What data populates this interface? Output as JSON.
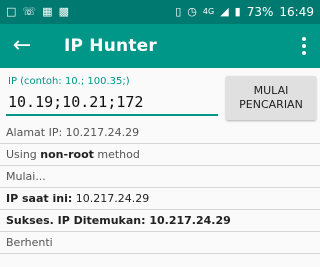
{
  "status_bar": {
    "battery": "73%",
    "time": "16:49",
    "icons": [
      "chat-bubble-icon",
      "whatsapp-icon",
      "image-icon",
      "bbm-icon",
      "sim-icon",
      "alarm-icon",
      "data-4g-icon",
      "signal-icon",
      "battery-icon"
    ]
  },
  "app_bar": {
    "title": "IP Hunter"
  },
  "form": {
    "ip_label": "IP (contoh: 10.; 100.35;)",
    "ip_value": "10.19;10.21;172",
    "button_label": "MULAI PENCARIAN"
  },
  "log": {
    "line1_label": "Alamat IP: ",
    "line1_value": "10.217.24.29",
    "line2_a": "Using ",
    "line2_b": "non-root",
    "line2_c": " method",
    "line3": "Mulai...",
    "line4_label": "IP saat ini:",
    "line4_value": " 10.217.24.29",
    "line5_label": "Sukses. IP Ditemukan:",
    "line5_value": " 10.217.24.29",
    "line6": "Berhenti"
  }
}
